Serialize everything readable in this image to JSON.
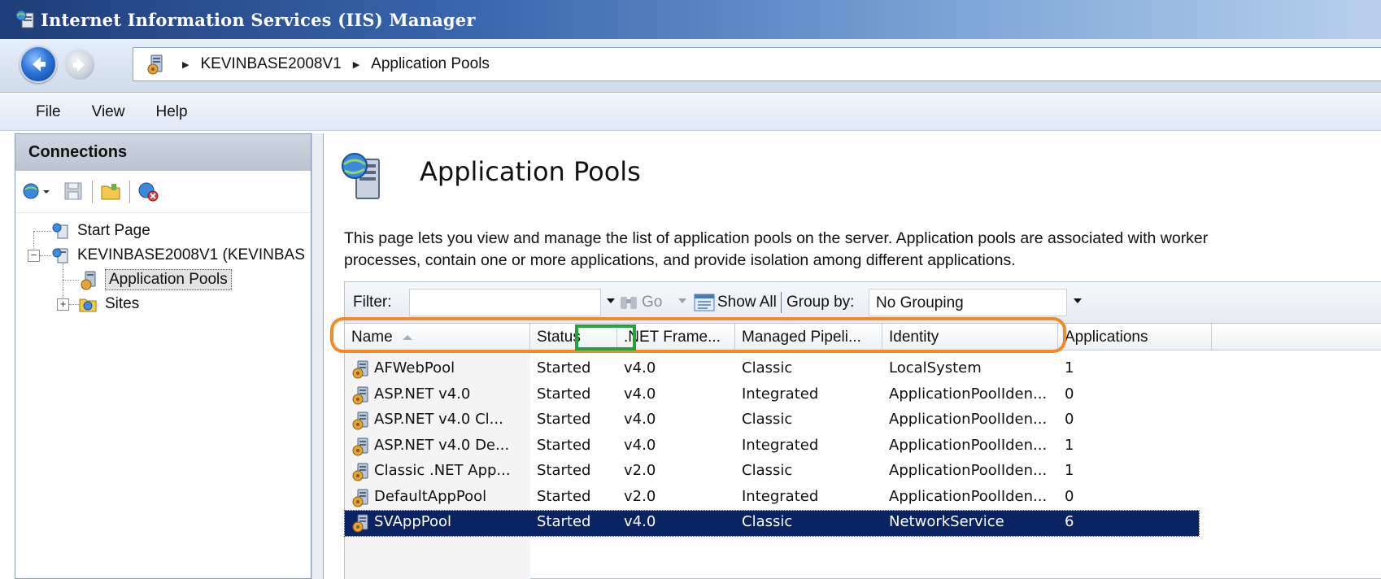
{
  "window": {
    "title": "Internet Information Services (IIS) Manager"
  },
  "address_bar": {
    "crumbs": [
      "KEVINBASE2008V1",
      "Application Pools"
    ]
  },
  "menu": {
    "items": [
      "File",
      "View",
      "Help"
    ]
  },
  "connections": {
    "header": "Connections",
    "tree": {
      "start_page": "Start Page",
      "server": "KEVINBASE2008V1 (KEVINBAS",
      "app_pools": "Application Pools",
      "sites": "Sites"
    }
  },
  "main": {
    "title": "Application Pools",
    "description_line1": "This page lets you view and manage the list of application pools on the server. Application pools are associated with worker",
    "description_line2": "processes, contain one or more applications, and provide isolation among different applications.",
    "filter": {
      "label": "Filter:",
      "value": "",
      "go_label": "Go",
      "show_all_label": "Show All",
      "group_by_label": "Group by:",
      "group_by_value": "No Grouping"
    },
    "columns": [
      "Name",
      "Status",
      ".NET Frame...",
      "Managed Pipeli...",
      "Identity",
      "Applications"
    ],
    "rows": [
      {
        "name": "AFWebPool",
        "status": "Started",
        "net": "v4.0",
        "pipeline": "Classic",
        "identity": "LocalSystem",
        "apps": "1"
      },
      {
        "name": "ASP.NET v4.0",
        "status": "Started",
        "net": "v4.0",
        "pipeline": "Integrated",
        "identity": "ApplicationPoolIden...",
        "apps": "0"
      },
      {
        "name": "ASP.NET v4.0 Cl...",
        "status": "Started",
        "net": "v4.0",
        "pipeline": "Classic",
        "identity": "ApplicationPoolIden...",
        "apps": "0"
      },
      {
        "name": "ASP.NET v4.0 De...",
        "status": "Started",
        "net": "v4.0",
        "pipeline": "Integrated",
        "identity": "ApplicationPoolIden...",
        "apps": "1"
      },
      {
        "name": "Classic .NET App...",
        "status": "Started",
        "net": "v2.0",
        "pipeline": "Classic",
        "identity": "ApplicationPoolIden...",
        "apps": "1"
      },
      {
        "name": "DefaultAppPool",
        "status": "Started",
        "net": "v2.0",
        "pipeline": "Integrated",
        "identity": "ApplicationPoolIden...",
        "apps": "0"
      },
      {
        "name": "SVAppPool",
        "status": "Started",
        "net": "v4.0",
        "pipeline": "Classic",
        "identity": "NetworkService",
        "apps": "6"
      }
    ],
    "selected_row": "SVAppPool"
  },
  "colors": {
    "selection": "#0a2463",
    "highlight_orange": "#f08a2c",
    "highlight_green": "#23a33c"
  },
  "icons": [
    "iis-icon",
    "back-arrow-icon",
    "forward-arrow-icon",
    "app-pool-icon",
    "server-icon",
    "sites-folder-icon",
    "connect-icon",
    "save-icon",
    "folder-icon",
    "disconnect-icon",
    "binoculars-icon",
    "show-all-icon"
  ]
}
